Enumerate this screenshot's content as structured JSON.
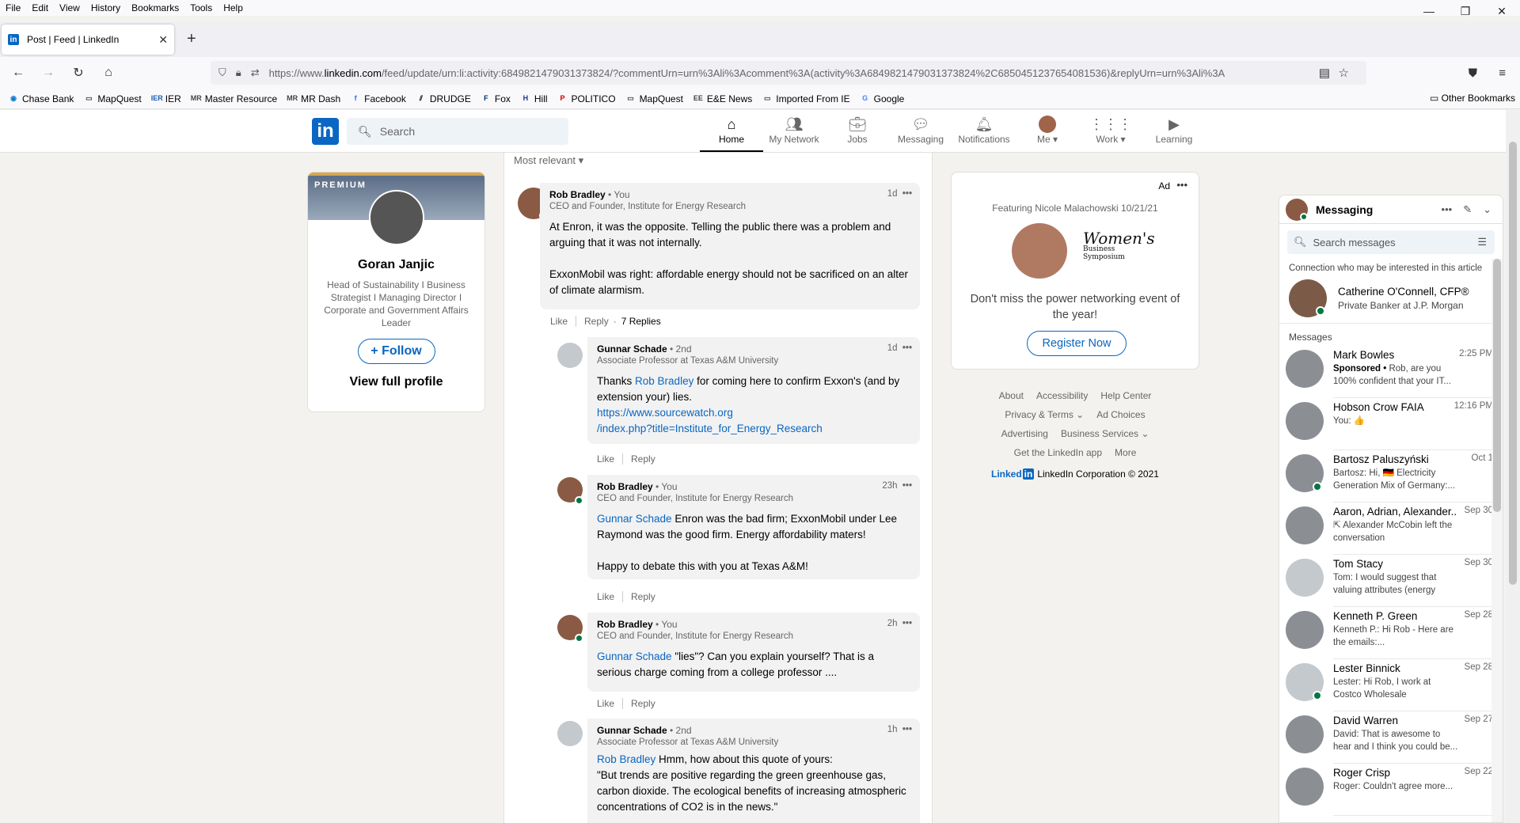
{
  "browser": {
    "menu": [
      "File",
      "Edit",
      "View",
      "History",
      "Bookmarks",
      "Tools",
      "Help"
    ],
    "tab_title": "Post | Feed | LinkedIn",
    "url_prefix": "https://www.",
    "url_host": "linkedin.com",
    "url_rest": "/feed/update/urn:li:activity:6849821479031373824/?commentUrn=urn%3Ali%3Acomment%3A(activity%3A6849821479031373824%2C6850451237654081536)&replyUrn=urn%3Ali%3A",
    "bookmarks": [
      {
        "label": "Chase Bank",
        "icon": "chase-icon",
        "color": "#117aca"
      },
      {
        "label": "MapQuest",
        "icon": "folder-map-icon",
        "color": "#444"
      },
      {
        "label": "IER",
        "icon": "ier-icon",
        "color": "#1a5fb4"
      },
      {
        "label": "Master Resource",
        "icon": "mr-icon",
        "color": "#444"
      },
      {
        "label": "MR Dash",
        "icon": "mr-icon",
        "color": "#444"
      },
      {
        "label": "Facebook",
        "icon": "facebook-icon",
        "color": "#1877f2"
      },
      {
        "label": "DRUDGE",
        "icon": "drudge-icon",
        "color": "#000"
      },
      {
        "label": "Fox",
        "icon": "fox-icon",
        "color": "#003366"
      },
      {
        "label": "Hill",
        "icon": "hill-icon",
        "color": "#1a3a8a"
      },
      {
        "label": "POLITICO",
        "icon": "politico-icon",
        "color": "#c00"
      },
      {
        "label": "MapQuest",
        "icon": "folder-map-icon",
        "color": "#444"
      },
      {
        "label": "E&E News",
        "icon": "ee-icon",
        "color": "#444"
      },
      {
        "label": "Imported From IE",
        "icon": "folder-icon",
        "color": "#444"
      },
      {
        "label": "Google",
        "icon": "google-icon",
        "color": "#4285f4"
      }
    ],
    "other_bookmarks": "Other Bookmarks"
  },
  "linkedin": {
    "search_placeholder": "Search",
    "nav": [
      {
        "label": "Home",
        "icon": "home-icon"
      },
      {
        "label": "My Network",
        "icon": "network-icon"
      },
      {
        "label": "Jobs",
        "icon": "jobs-icon"
      },
      {
        "label": "Messaging",
        "icon": "messaging-icon"
      },
      {
        "label": "Notifications",
        "icon": "bell-icon"
      },
      {
        "label": "Me",
        "icon": "avatar"
      },
      {
        "label": "Work",
        "icon": "grid-icon"
      },
      {
        "label": "Learning",
        "icon": "learning-icon"
      }
    ]
  },
  "profile": {
    "badge": "PREMIUM",
    "name": "Goran Janjic",
    "headline": "Head of Sustainability I Business Strategist I Managing Director I Corporate and Government Affairs Leader",
    "follow_label": "Follow",
    "view_full": "View full profile"
  },
  "feed": {
    "sort_label": "Most relevant",
    "comments": [
      {
        "name": "Rob Bradley",
        "degree": " • You",
        "title": "CEO and Founder, Institute for Energy Research",
        "time": "1d",
        "mention": "",
        "text": "At Enron, it was the opposite. Telling the public there was a problem and arguing that it was not internally.\n\nExxonMobil was right: affordable energy should not be sacrificed on an alter of climate alarmism.",
        "like": "Like",
        "reply": "Reply",
        "replies": "7 Replies"
      },
      {
        "name": "Gunnar Schade",
        "degree": " • 2nd",
        "title": "Associate Professor at Texas A&M University",
        "time": "1d",
        "pre": "Thanks ",
        "mention": "Rob Bradley",
        "post": " for coming here to confirm Exxon's (and by extension your) lies.",
        "link1": "https://www.sourcewatch.org",
        "link2": "/index.php?title=Institute_for_Energy_Research",
        "like": "Like",
        "reply": "Reply"
      },
      {
        "name": "Rob Bradley",
        "degree": " • You",
        "title": "CEO and Founder, Institute for Energy Research",
        "time": "23h",
        "mention": "Gunnar Schade",
        "post": " Enron was the bad firm; ExxonMobil under Lee Raymond was the good firm. Energy affordability maters!\n\nHappy to debate this with you at Texas A&M!",
        "like": "Like",
        "reply": "Reply"
      },
      {
        "name": "Rob Bradley",
        "degree": " • You",
        "title": "CEO and Founder, Institute for Energy Research",
        "time": "2h",
        "mention": "Gunnar Schade",
        "post": " \"lies\"? Can you explain yourself? That is a serious charge coming from a college professor ....",
        "like": "Like",
        "reply": "Reply"
      },
      {
        "name": "Gunnar Schade",
        "degree": " • 2nd",
        "title": "Associate Professor at Texas A&M University",
        "time": "1h",
        "mention": "Rob Bradley",
        "post": " Hmm, how about this quote of yours:\n\"But trends are positive regarding the green greenhouse gas, carbon dioxide. The ecological benefits of increasing atmospheric concentrations of CO2 is in the news.\""
      }
    ]
  },
  "ad": {
    "label": "Ad",
    "featuring": "Featuring Nicole Malachowski 10/21/21",
    "logo_main": "Women's",
    "logo_sub": "Business Symposium",
    "text": "Don't miss the power networking event of the year!",
    "button": "Register Now"
  },
  "footer": {
    "links_row1": [
      "About",
      "Accessibility",
      "Help Center"
    ],
    "links_row2": [
      "Privacy & Terms ⌄",
      "Ad Choices"
    ],
    "links_row3": [
      "Advertising",
      "Business Services ⌄"
    ],
    "links_row4": [
      "Get the LinkedIn app",
      "More"
    ],
    "logo": "Linked",
    "copyright": "LinkedIn Corporation © 2021"
  },
  "messaging": {
    "title": "Messaging",
    "search_placeholder": "Search messages",
    "connection_hint": "Connection who may be interested in this article",
    "connection": {
      "name": "Catherine O'Connell, CFP®",
      "sub": "Private Banker at J.P. Morgan"
    },
    "section": "Messages",
    "threads": [
      {
        "name": "Mark Bowles",
        "date": "2:25 PM",
        "bold": "Sponsored • ",
        "preview": " Rob, are you 100% confident that your IT...",
        "online": false
      },
      {
        "name": "Hobson Crow FAIA",
        "date": "12:16 PM",
        "preview": "You: 👍",
        "online": false
      },
      {
        "name": "Bartosz Paluszyński",
        "date": "Oct 1",
        "preview": "Bartosz: Hi, 🇩🇪 Electricity Generation Mix of Germany:...",
        "online": true
      },
      {
        "name": "Aaron, Adrian, Alexander...",
        "date": "Sep 30",
        "preview": "⇱ Alexander McCobin left the conversation",
        "online": false
      },
      {
        "name": "Tom Stacy",
        "date": "Sep 30",
        "preview": "Tom: I would suggest that valuing attributes (energy (fuel)...",
        "online": false,
        "gray": true
      },
      {
        "name": "Kenneth P. Green",
        "date": "Sep 28",
        "preview": "Kenneth P.: Hi Rob - Here are the emails:...",
        "online": false
      },
      {
        "name": "Lester Binnick",
        "date": "Sep 28",
        "preview": "Lester: Hi Rob, I work at Costco Wholesale permanent...",
        "online": true,
        "gray": true
      },
      {
        "name": "David Warren",
        "date": "Sep 27",
        "preview": "David: That is awesome to hear and I think you could be...",
        "online": false
      },
      {
        "name": "Roger Crisp",
        "date": "Sep 22",
        "preview": "Roger: Couldn't agree more...",
        "online": false
      }
    ]
  }
}
